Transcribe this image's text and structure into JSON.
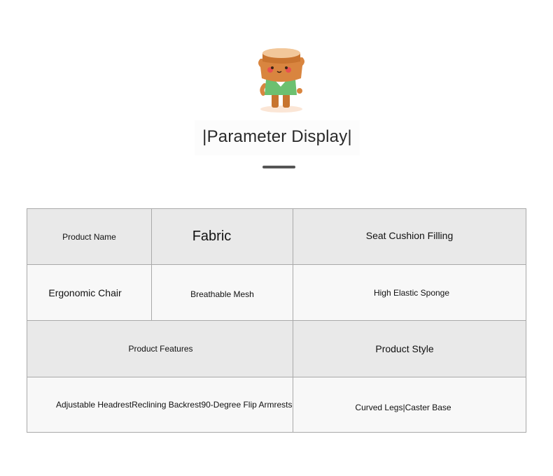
{
  "header": {
    "title": "|Parameter Display|"
  },
  "mascot": {
    "icon": "tree-stump-mascot-icon",
    "colors": {
      "body": "#d9853f",
      "shirt": "#6cc070",
      "cheek": "#e8504f"
    }
  },
  "table": {
    "row1": {
      "product_name_label": "Product Name",
      "material_value": "Fabric",
      "filling_label": "Seat Cushion Filling"
    },
    "row2": {
      "product_name_value": "Ergonomic Chair",
      "material_detail": "Breathable Mesh",
      "filling_value": "High Elastic Sponge"
    },
    "row3": {
      "features_label": "Product Features",
      "style_label": "Product Style"
    },
    "row4": {
      "features_value": "Adjustable HeadrestReclining Backrest90-Degree Flip Armrests",
      "style_value": "Curved Legs|Caster Base"
    }
  },
  "colors": {
    "header_row": "#e9e9e9",
    "value_row": "#f8f8f8",
    "border": "#a9a9a9",
    "divider": "#555555"
  }
}
